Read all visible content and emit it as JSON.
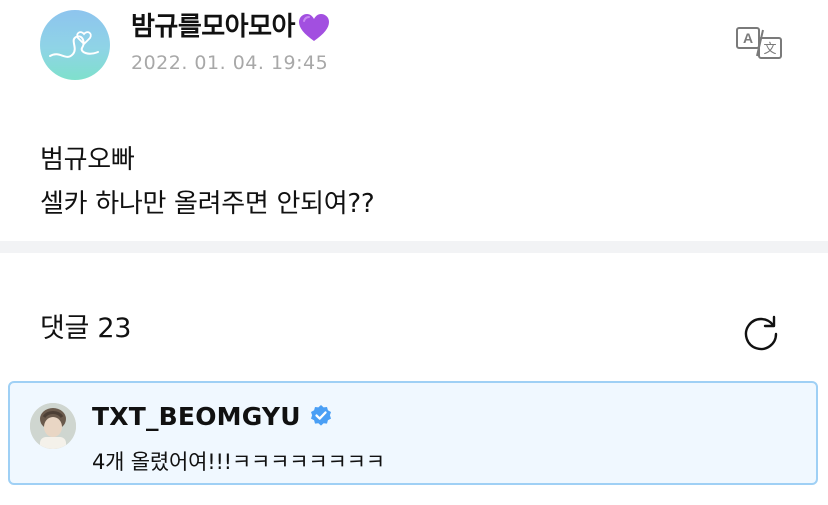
{
  "post": {
    "author": "밤규를모아모아",
    "author_emoji": "purple-heart",
    "date": "2022. 01. 04. 19:45",
    "body_lines": [
      "범규오빠",
      "셀카 하나만 올려주면 안되여??"
    ],
    "translate_icon": "translate-icon"
  },
  "comments": {
    "title": "댓글 23",
    "refresh_icon": "refresh-icon",
    "items": [
      {
        "author": "TXT_BEOMGYU",
        "verified": true,
        "text": "4개 올렸어여!!!ㅋㅋㅋㅋㅋㅋㅋㅋ"
      }
    ]
  },
  "colors": {
    "verified_badge": "#4a9ff5",
    "comment_border": "#9fd0f5",
    "comment_bg": "#f0f8ff",
    "heart": "#a24fe0",
    "date_text": "#a8a8a8"
  }
}
